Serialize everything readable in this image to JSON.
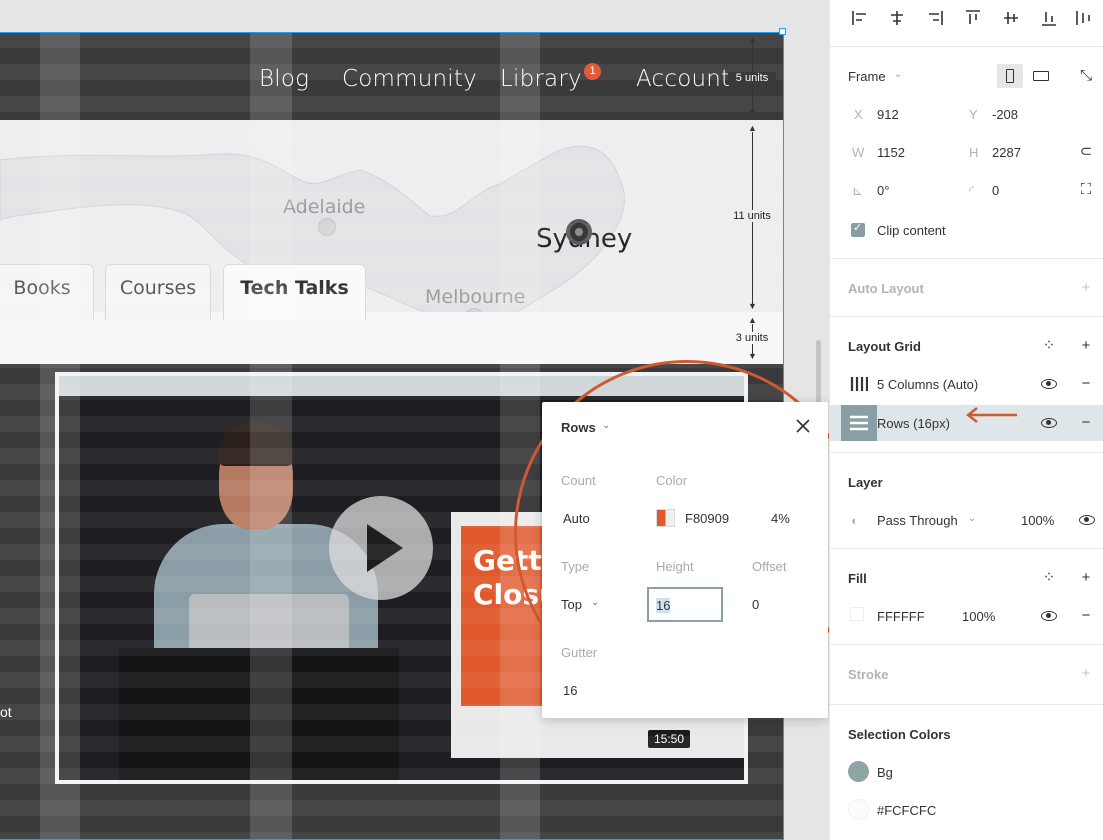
{
  "nav": {
    "links": [
      "Blog",
      "Community",
      "Library",
      "Account"
    ],
    "library_badge": "1"
  },
  "map": {
    "cities": [
      "Adelaide",
      "Sydney",
      "Melbourne"
    ]
  },
  "tabs": [
    "Books",
    "Courses",
    "Tech Talks"
  ],
  "video": {
    "slide_text": "Getti\nClosu",
    "duration": "15:50"
  },
  "left_fragment": "ot",
  "measurements": [
    "5 units",
    "11 units",
    "3 units"
  ],
  "panel": {
    "frame": {
      "label": "Frame",
      "x_label": "X",
      "x": "912",
      "y_label": "Y",
      "y": "-208",
      "w_label": "W",
      "w": "1152",
      "h_label": "H",
      "h": "2287",
      "rotation": "0°",
      "radius": "0",
      "clip_content": "Clip content"
    },
    "auto_layout": "Auto Layout",
    "layout_grid": {
      "title": "Layout Grid",
      "items": [
        "5 Columns (Auto)",
        "Rows (16px)"
      ]
    },
    "layer": {
      "title": "Layer",
      "blend": "Pass Through",
      "opacity": "100%"
    },
    "fill": {
      "title": "Fill",
      "hex": "FFFFFF",
      "opacity": "100%"
    },
    "stroke": "Stroke",
    "selection_colors": {
      "title": "Selection Colors",
      "items": [
        "Bg",
        "#FCFCFC"
      ]
    }
  },
  "popover": {
    "title": "Rows",
    "count_label": "Count",
    "count": "Auto",
    "color_label": "Color",
    "color_hex": "F80909",
    "color_opacity": "4%",
    "type_label": "Type",
    "type": "Top",
    "height_label": "Height",
    "height": "16",
    "offset_label": "Offset",
    "offset": "0",
    "gutter_label": "Gutter",
    "gutter": "16"
  },
  "colors": {
    "accent": "#18a0fb",
    "annotation": "#d05a30",
    "swatch": "#F80909",
    "bg_swatch": "#8fa4a4"
  }
}
